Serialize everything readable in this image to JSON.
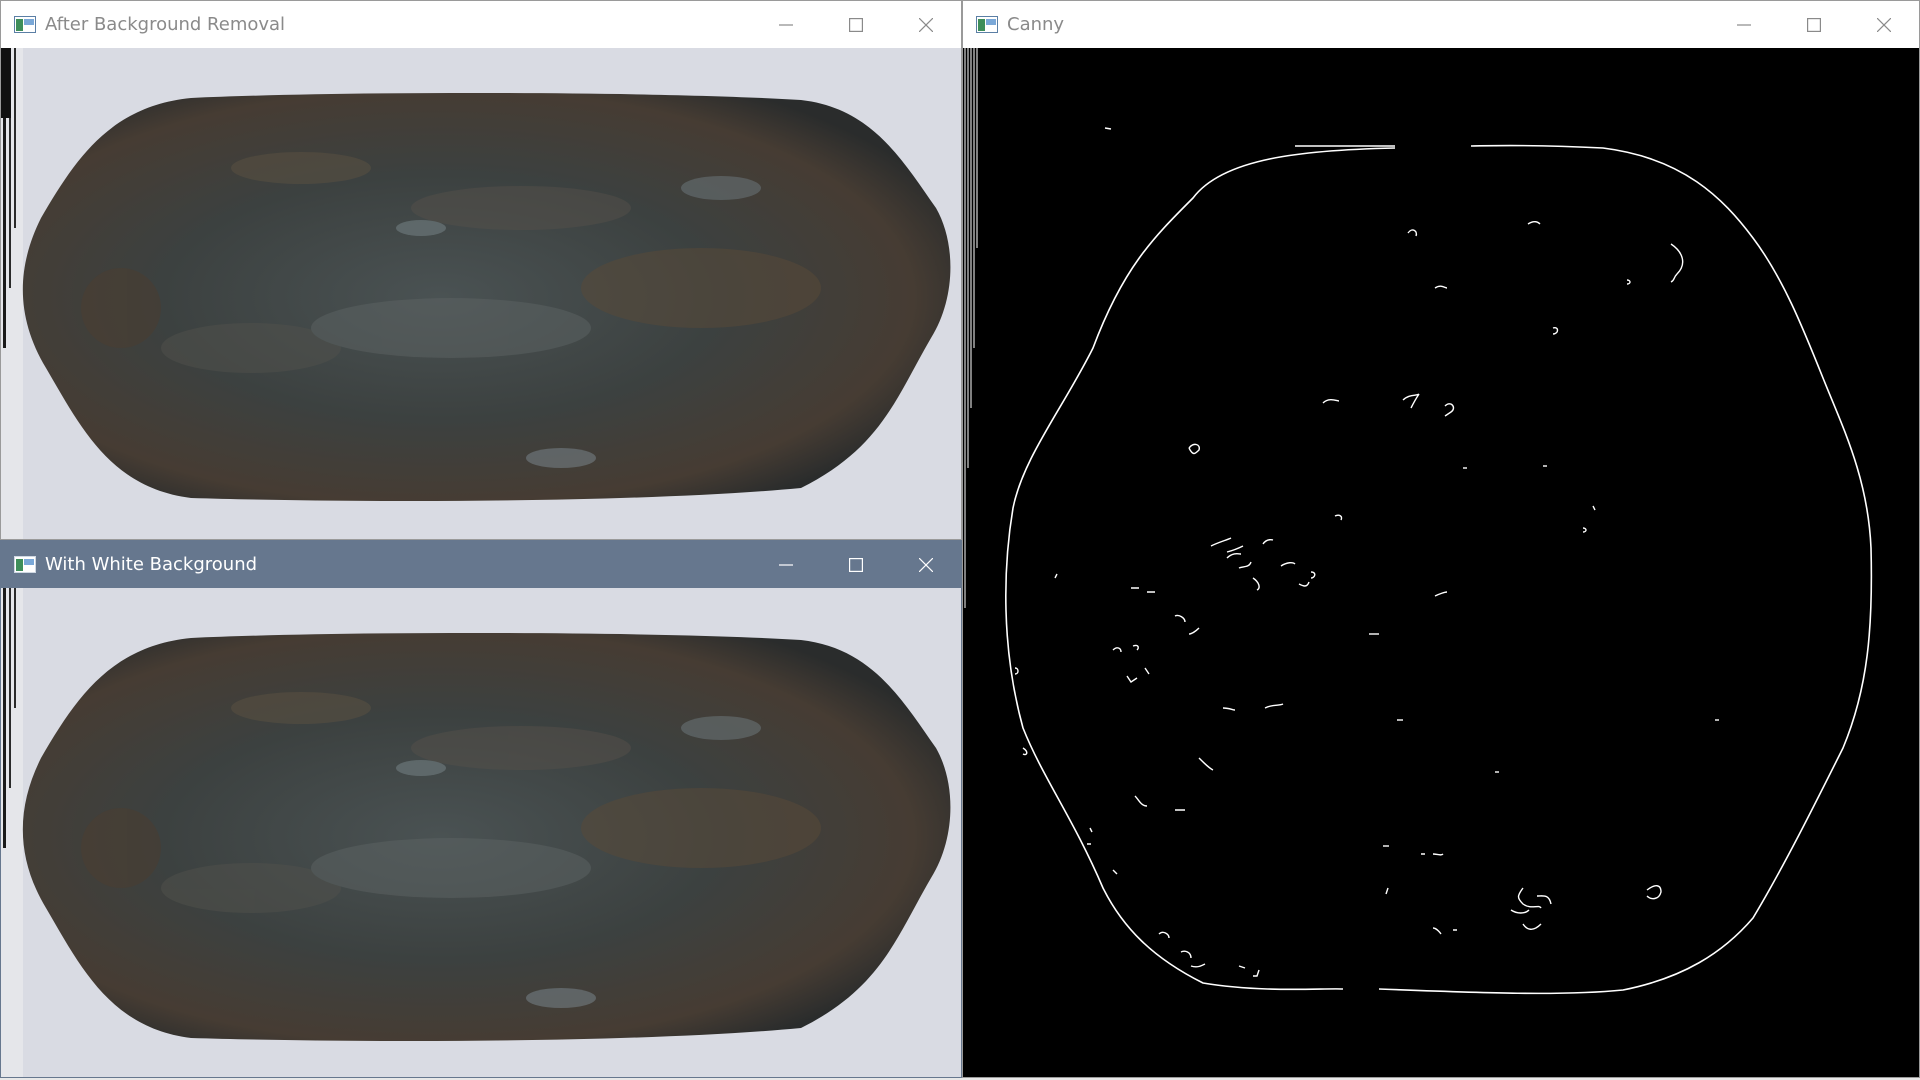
{
  "windows": {
    "after_bg": {
      "title": "After Background Removal",
      "icon": "opencv-window-icon",
      "buttons": [
        "minimize-icon",
        "maximize-icon",
        "close-icon"
      ]
    },
    "white_bg": {
      "title": "With White Background",
      "icon": "opencv-window-icon",
      "buttons": [
        "minimize-icon",
        "maximize-icon",
        "close-icon"
      ]
    },
    "canny": {
      "title": "Canny",
      "icon": "opencv-window-icon",
      "buttons": [
        "minimize-icon",
        "maximize-icon",
        "close-icon"
      ]
    }
  },
  "colors": {
    "active_titlebar": "#66778e",
    "inactive_titlebar": "#ffffff",
    "photo_background": "#d9dbe3",
    "stone_dark": "#2e3336",
    "canny_background": "#000000",
    "edge_color": "#ffffff"
  }
}
